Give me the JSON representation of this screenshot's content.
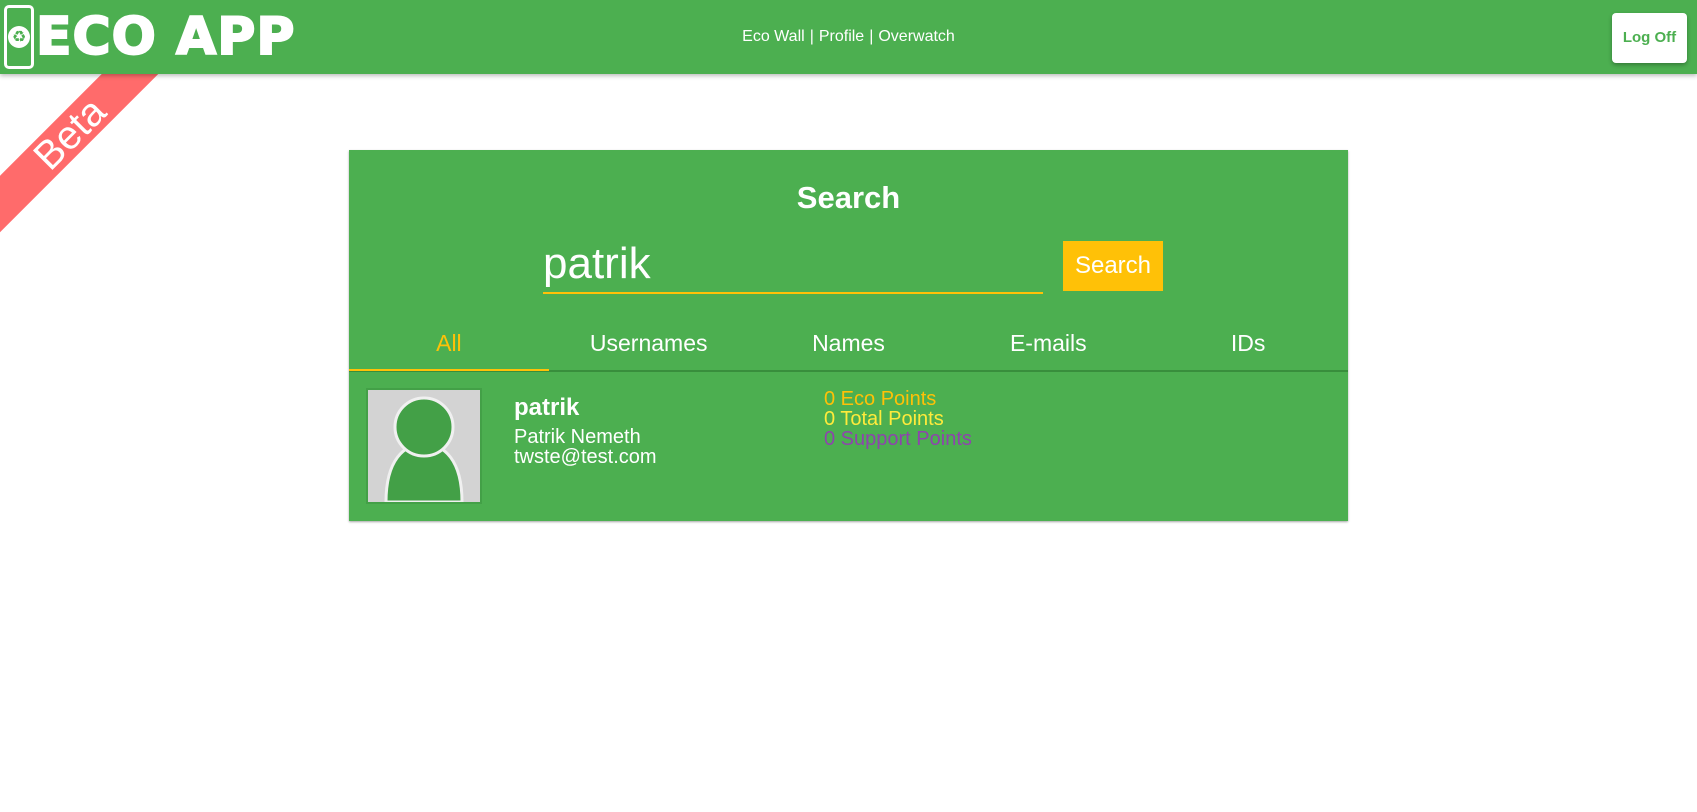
{
  "header": {
    "logo_text": "ECO APP",
    "nav": {
      "eco_wall": "Eco Wall",
      "separator_1": "|",
      "profile": "Profile",
      "separator_2": "|",
      "overwatch": "Overwatch"
    },
    "logoff_label": "Log Off"
  },
  "ribbon": {
    "label": "Beta"
  },
  "search": {
    "title": "Search",
    "query": "patrik",
    "button_label": "Search",
    "tabs": [
      {
        "label": "All",
        "active": true
      },
      {
        "label": "Usernames",
        "active": false
      },
      {
        "label": "Names",
        "active": false
      },
      {
        "label": "E-mails",
        "active": false
      },
      {
        "label": "IDs",
        "active": false
      }
    ]
  },
  "results": [
    {
      "username": "patrik",
      "full_name": "Patrik Nemeth",
      "email": "twste@test.com",
      "eco_points": "0 Eco Points",
      "total_points": "0 Total Points",
      "support_points": "0 Support Points"
    }
  ],
  "colors": {
    "primary": "#4caf50",
    "accent": "#ffc107",
    "ribbon": "#ff6b6b",
    "total_points": "#ffeb3b",
    "support_points": "#8e44ad"
  },
  "icons": {
    "logo": "recycle-phone-icon",
    "avatar": "user-silhouette-icon"
  }
}
